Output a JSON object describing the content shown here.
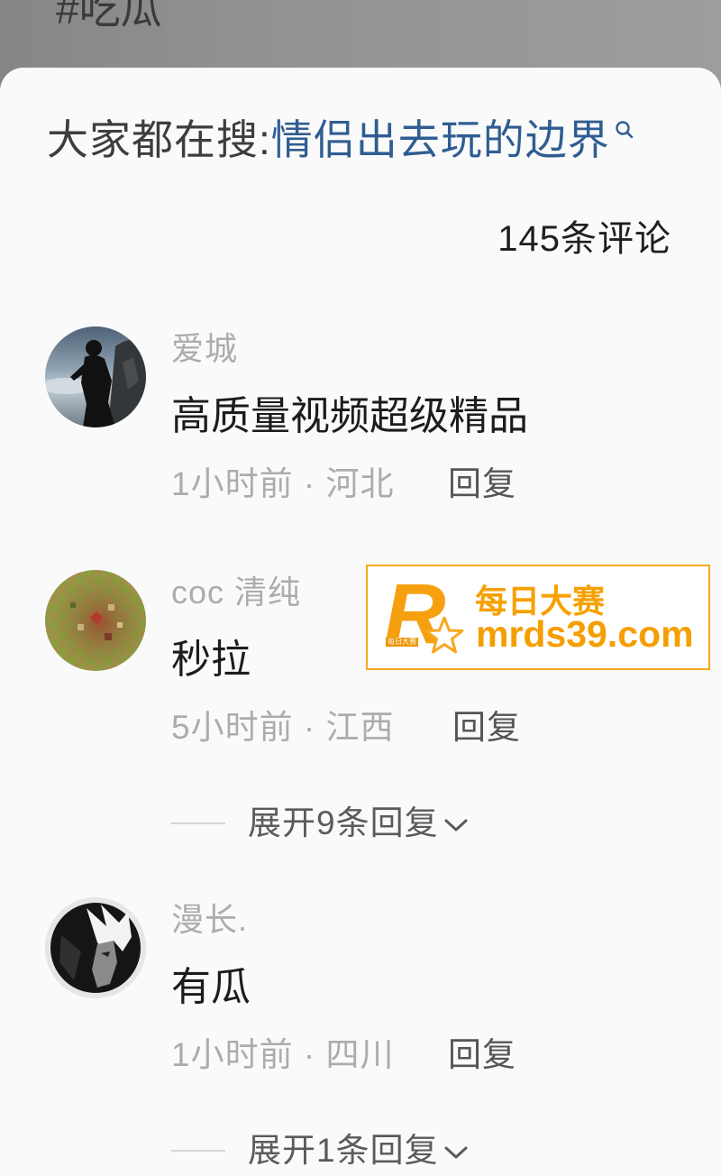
{
  "topic_tag": "#吃瓜",
  "search_suggest": {
    "prefix": "大家都在搜:",
    "query": "情侣出去玩的边界",
    "icon": "search-icon"
  },
  "comment_count": "145条评论",
  "comments": [
    {
      "user": "爱城",
      "text": "高质量视频超级精品",
      "meta": "1小时前 · 河北",
      "reply_label": "回复"
    },
    {
      "user": "coc 清纯",
      "text": "秒拉",
      "meta": "5小时前 · 江西",
      "reply_label": "回复",
      "expand_label": "展开9条回复",
      "expand_icon": "chevron-down-icon"
    },
    {
      "user": "漫长.",
      "text": "有瓜",
      "meta": "1小时前 · 四川",
      "reply_label": "回复",
      "expand_label": "展开1条回复",
      "expand_icon": "chevron-down-icon"
    }
  ],
  "watermark": {
    "logo_letter": "R",
    "logo_caption": "每日大赛",
    "logo_icon": "star-icon",
    "title": "每日大赛",
    "url": "mrds39.com"
  },
  "colors": {
    "background": "#fafafa",
    "overlay_top": "#939393",
    "link_blue": "#2f5d91",
    "text_primary": "#1c1c1c",
    "text_secondary": "#acacac",
    "reply": "#555555",
    "watermark_orange": "#f6a81c"
  }
}
